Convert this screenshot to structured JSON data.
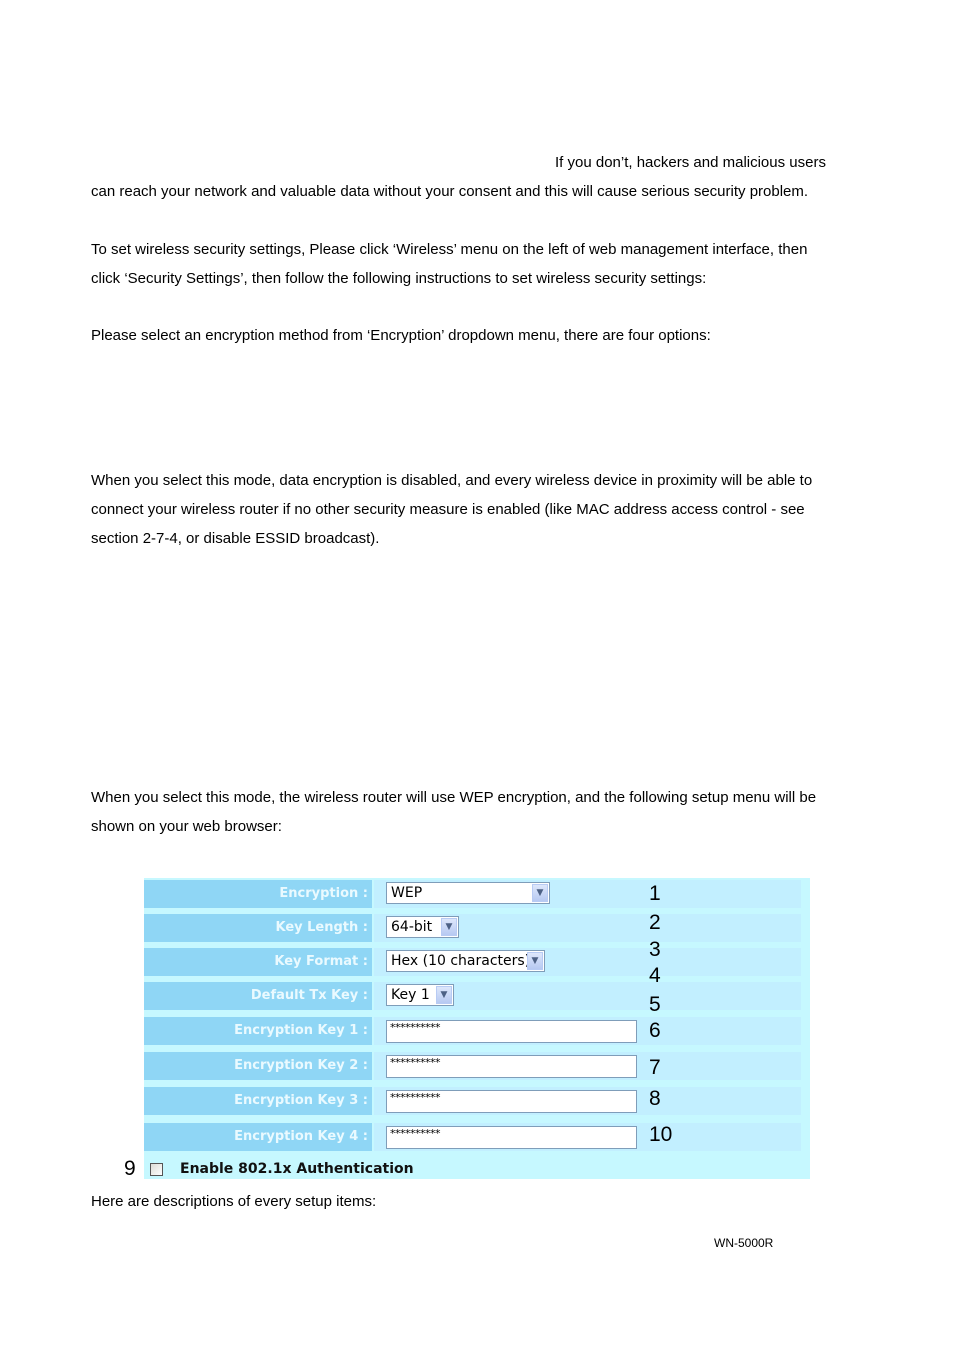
{
  "intro": {
    "line1": "If you don’t, hackers and malicious users",
    "line2": "can reach your network and valuable data without your consent and this will cause serious security problem."
  },
  "instructions": {
    "line1": "To set wireless security settings, Please click ‘Wireless’ menu on the left of web management interface, then",
    "line2": "click ‘Security Settings’, then follow the following instructions to set wireless security settings:"
  },
  "select_prompt": "Please select an encryption method from ‘Encryption’ dropdown menu, there are four options:",
  "disable_mode": {
    "line1": "When you select this mode, data encryption is disabled, and every wireless device in proximity will be able to",
    "line2": "connect your wireless router if no other security measure is enabled (like MAC address access control - see",
    "line3": "section 2-7-4, or disable ESSID broadcast)."
  },
  "wep_mode": {
    "line1": "When you select this mode, the wireless router will use WEP encryption, and the following setup menu will be",
    "line2": "shown on your web browser:"
  },
  "panel": {
    "encryption": {
      "label": "Encryption :",
      "value": "WEP",
      "callout": "1"
    },
    "key_length": {
      "label": "Key Length :",
      "value": "64-bit",
      "callout": "2"
    },
    "key_format": {
      "label": "Key Format :",
      "value": "Hex (10 characters)",
      "callout": "3"
    },
    "default_tx_key": {
      "label": "Default Tx Key :",
      "value": "Key 1",
      "callout": "4"
    },
    "callout_5": "5",
    "keys": [
      {
        "label": "Encryption Key 1 :",
        "value": "**********",
        "callout": "6"
      },
      {
        "label": "Encryption Key 2 :",
        "value": "**********",
        "callout": "7"
      },
      {
        "label": "Encryption Key 3 :",
        "value": "**********",
        "callout": "8"
      },
      {
        "label": "Encryption Key 4 :",
        "value": "**********",
        "callout": "10"
      }
    ],
    "auth": {
      "label": "Enable 802.1x Authentication",
      "checked": false,
      "callout": "9"
    },
    "arrow_glyph": "▼"
  },
  "descriptions_intro": "Here are descriptions of every setup items:",
  "footer": "WN-5000R"
}
